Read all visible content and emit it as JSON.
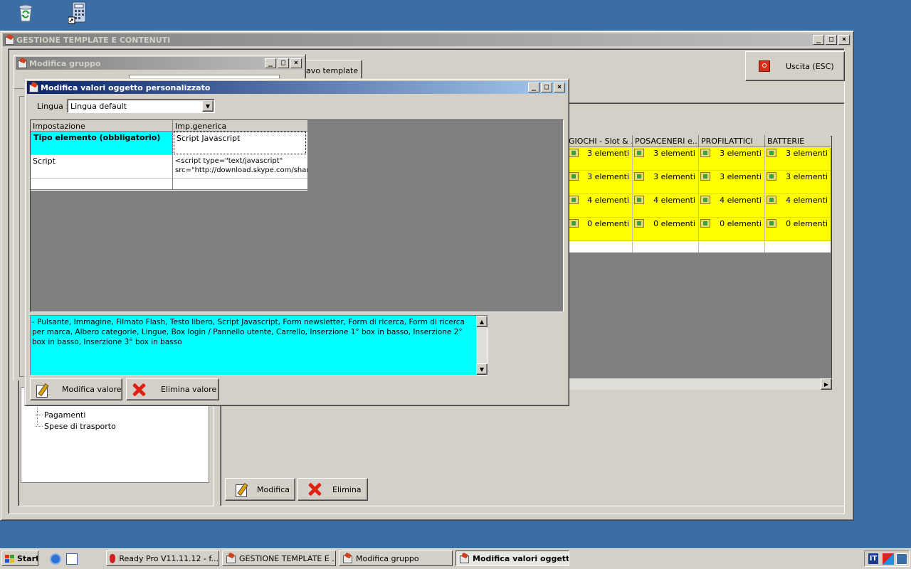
{
  "desktop": {
    "icons": [
      "recycle-bin-icon",
      "calculator-shortcut-icon"
    ]
  },
  "main_window": {
    "title": "GESTIONE TEMPLATE E CONTENUTI",
    "exit_button": "Uscita (ESC)",
    "new_template_button": "avo template",
    "columns": [
      "GIOCHI - Slot & ...",
      "POSACENERI e...",
      "PROFILATTICI",
      "BATTERIE"
    ],
    "rows": [
      [
        "3 elementi",
        "3 elementi",
        "3 elementi",
        "3 elementi"
      ],
      [
        "3 elementi",
        "3 elementi",
        "3 elementi",
        "3 elementi"
      ],
      [
        "4 elementi",
        "4 elementi",
        "4 elementi",
        "4 elementi"
      ],
      [
        "0 elementi",
        "0 elementi",
        "0 elementi",
        "0 elementi"
      ]
    ],
    "tree_items": [
      "Pagamenti",
      "Spese di trasporto"
    ],
    "modify_button": "Modifica",
    "delete_button": "Elimina"
  },
  "group_window": {
    "title": "Modifica gruppo"
  },
  "dialog": {
    "title": "Modifica valori oggetto personalizzato",
    "language_label": "Lingua :",
    "language_value": "Lingua default",
    "grid_headers": [
      "Impostazione",
      "Imp.generica"
    ],
    "grid_rows": [
      {
        "setting": "Tipo elemento (obbligatorio)",
        "value": "Script Javascript"
      },
      {
        "setting": "Script",
        "value_line1": "<script type=\"text/javascript\"",
        "value_line2": "src=\"http://download.skype.com/shar"
      }
    ],
    "description": "- Pulsante, Immagine, Filmato Flash, Testo libero, Script Javascript, Form newsletter, Form di ricerca, Form di ricerca per marca, Albero categorie, Lingue, Box login / Pannello utente, Carrello, Inserzione 1° box in basso, Inserzione 2° box in basso, Inserzione 3° box in basso",
    "modify_value_button": "Modifica valore",
    "delete_value_button": "Elimina valore"
  },
  "taskbar": {
    "start": "Start",
    "tasks": [
      "Ready Pro V11.11.12 - f...",
      "GESTIONE TEMPLATE E ...",
      "Modifica gruppo",
      "Modifica valori oggett..."
    ],
    "tray_language": "IT"
  }
}
